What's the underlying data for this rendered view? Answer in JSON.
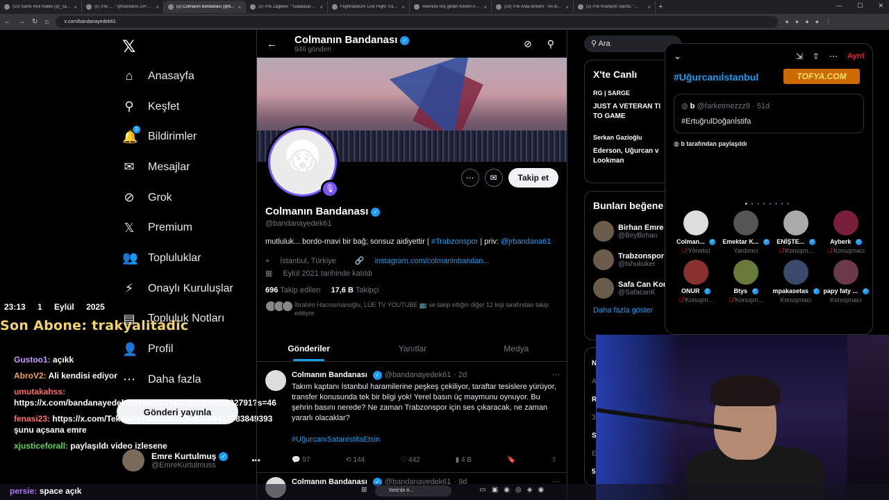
{
  "browser": {
    "tabs": [
      {
        "title": "(10) Samil Yeni Haber (@_samiy..."
      },
      {
        "title": "(5) X'te ... : \"@tserdarsx 20+5 ..."
      },
      {
        "title": "(2) Colmanın Bandanası (@b..."
      },
      {
        "title": "(2) X'te Zagbew: \"\"Galatasaray..."
      },
      {
        "title": "Flightradar24: Live Flight Track..."
      },
      {
        "title": "Ailemize hoş geldin Kerem Akt..."
      },
      {
        "title": "(19) X'te Arda Birbem: \"An itiba..."
      },
      {
        "title": "(5) X'te Krampon Sports: \"..."
      }
    ],
    "url": "x.com/bandanayedek61"
  },
  "nav": {
    "items": [
      {
        "label": "Anasayfa",
        "icon": "home-icon",
        "glyph": "⌂"
      },
      {
        "label": "Keşfet",
        "icon": "search-icon",
        "glyph": "⚲"
      },
      {
        "label": "Bildirimler",
        "icon": "bell-icon",
        "glyph": "🔔",
        "badge": "2"
      },
      {
        "label": "Mesajlar",
        "icon": "mail-icon",
        "glyph": "✉"
      },
      {
        "label": "Grok",
        "icon": "grok-icon",
        "glyph": "⊘"
      },
      {
        "label": "Premium",
        "icon": "x-logo-icon",
        "glyph": "𝕏"
      },
      {
        "label": "Topluluklar",
        "icon": "people-icon",
        "glyph": "👥"
      },
      {
        "label": "Onaylı Kuruluşlar",
        "icon": "bolt-icon",
        "glyph": "⚡"
      },
      {
        "label": "Topluluk Notları",
        "icon": "notes-icon",
        "glyph": "▤"
      },
      {
        "label": "Profil",
        "icon": "person-icon",
        "glyph": "👤"
      },
      {
        "label": "Daha fazla",
        "icon": "more-icon",
        "glyph": "⋯"
      }
    ],
    "post_button": "Gönderi yayınla",
    "me": {
      "name": "Emre Kurtulmuş",
      "handle": "@EmreKurtulmuss"
    }
  },
  "overlay": {
    "time": "23:13",
    "date": "1 Eylül 2025",
    "last_sub": "Son Abone: trakyalitadic",
    "chat": [
      {
        "user": "Gustoo1:",
        "text": "açıkk"
      },
      {
        "user": "AbroV2:",
        "text": "Ali kendisi ediyor"
      },
      {
        "user": "umutakahss:",
        "text": "https://x.com/bandanayedek61/status/1962591699995082791?s=46"
      },
      {
        "user": "fenasi23:",
        "text": "https://x.com/TekYolFener/status/1962609417783849393 şunu açsana emre"
      },
      {
        "user": "xjusticeforall:",
        "text": "paylaşıldı video izlesene"
      }
    ],
    "bottom_msg_user": "persie:",
    "bottom_msg_text": "space açık"
  },
  "profile": {
    "header_name": "Colmanın Bandanası",
    "post_count": "946 gönderi",
    "name": "Colmanın Bandanası",
    "handle": "@bandanayedek61",
    "bio_prefix": "mutluluk... bordo-mavi bir bağ; sonsuz aidiyettir | ",
    "bio_link1": "#Trabzonspor",
    "bio_mid": " | priv: ",
    "bio_link2": "@jrbandana61",
    "location": "İstanbul, Türkiye",
    "website": "instagram.com/colmaninbandan...",
    "joined": "Eylül 2021 tarihinde katıldı",
    "following_count": "696",
    "following_label": "Takip edilen",
    "followers_count": "17,6 B",
    "followers_label": "Takipçi",
    "followed_by": "İbrahim Hacıosmanoğlu, LÜE TV YOUTUBE 📺 ve takip ettiğin diğer 12 kişi tarafından takip ediliyor",
    "follow_button": "Takip et",
    "tabs": [
      "Gönderiler",
      "Yanıtlar",
      "Medya"
    ]
  },
  "tweets": [
    {
      "name": "Colmanın Bandanası",
      "handle": "@bandanayedek61",
      "time": "· 2d",
      "text": "Takım kaptanı İstanbul haramilerine peşkeş çekiliyor, taraftar tesislere yürüyor, transfer konusunda tek bir bilgi yok! Yerel basın üç maymunu oynuyor. Bu şehrin basını nerede? Ne zaman Trabzonspor için ses çıkaracak, ne zaman yararlı olacaklar?",
      "hashtag": "#UğurcanıSatanİstifaEtsin",
      "replies": "97",
      "retweets": "144",
      "likes": "442",
      "views": "4 B"
    },
    {
      "name": "Colmanın Bandanası",
      "handle": "@bandanayedek61",
      "time": "· 9d"
    }
  ],
  "right": {
    "search_placeholder": "Ara",
    "live_title": "X'te Canlı",
    "live": [
      {
        "who": "RG | SARGE",
        "text": "JUST A VETERAN TI\nTO GAME"
      },
      {
        "who": "Serkan Gazioğlu",
        "text": "Ederson, Uğurcan v\nLookman"
      }
    ],
    "wtf_title": "Bunları beğene",
    "wtf": [
      {
        "name": "Birhan Emre",
        "handle": "@BeyBirhan"
      },
      {
        "name": "Trabzonspor",
        "handle": "@tshukuker"
      },
      {
        "name": "Safa Can Kor",
        "handle": "@SafacanK"
      }
    ],
    "show_more": "Daha fazla göster",
    "partial_lines": [
      "N",
      "A",
      "R",
      "3",
      "S",
      "E",
      "5"
    ]
  },
  "space": {
    "title": "#Uğurcanıİstanbul",
    "leave": "Ayrıl",
    "overlay_logo": "TOFYA.COM",
    "pinned_name": "b",
    "pinned_handle": "@farketmezzz8 · 51d",
    "pinned_text": "#ErtuğrulDoğanİstifa",
    "shared_by": "b tarafından paylaşıldı",
    "people": [
      {
        "name": "Colman...",
        "role": "Yönetici",
        "color": "#dddddd",
        "muted": true
      },
      {
        "name": "Emektar K...",
        "role": "Yardımcı",
        "color": "#555555",
        "muted": false
      },
      {
        "name": "ENİŞTE...",
        "role": "Konuşm...",
        "color": "#aaaaaa",
        "muted": true
      },
      {
        "name": "Ayberk",
        "role": "Konuşmacı",
        "color": "#7a1f3a",
        "muted": true
      },
      {
        "name": "ONUR",
        "role": "Konuşm...",
        "color": "#8a3030",
        "muted": true
      },
      {
        "name": "Btys",
        "role": "Konuşm...",
        "color": "#6a7a3a",
        "muted": true
      },
      {
        "name": "mpakasetas",
        "role": "Konuşmacı",
        "color": "#3a4a6a",
        "muted": false
      },
      {
        "name": "papy faty ...",
        "role": "Konuşmacı",
        "color": "#6a3a4a",
        "muted": false
      }
    ]
  },
  "taskbar": {
    "search": "Web'de A..."
  },
  "colors": {
    "accent": "#1d9bf0",
    "spaces": "#7856ff",
    "danger": "#f4212e"
  }
}
